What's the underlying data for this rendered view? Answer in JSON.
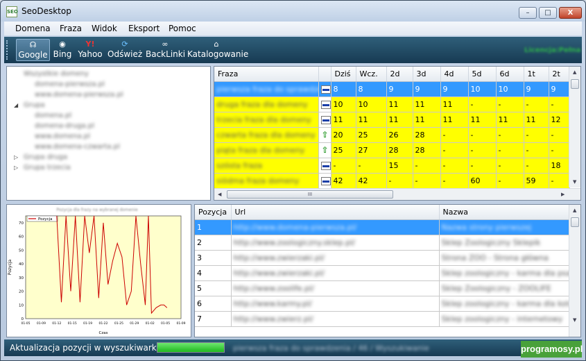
{
  "window": {
    "title": "SeoDesktop",
    "min": "–",
    "max": "□",
    "close": "X"
  },
  "menu": [
    "Domena",
    "Fraza",
    "Widok",
    "Eksport",
    "Pomoc"
  ],
  "toolbar": {
    "buttons": [
      {
        "label": "Google",
        "icon": "google-icon",
        "active": true
      },
      {
        "label": "Bing",
        "icon": "bing-icon"
      },
      {
        "label": "Yahoo",
        "icon": "yahoo-icon"
      },
      {
        "label": "Odśwież",
        "icon": "refresh-icon"
      },
      {
        "label": "BackLinki",
        "icon": "link-icon"
      },
      {
        "label": "Katalogowanie",
        "icon": "catalog-icon"
      }
    ],
    "license": "Licencja:Pełna"
  },
  "tree": [
    {
      "label": "Wszystkie domeny",
      "level": 0,
      "toggle": ""
    },
    {
      "label": "domena-pierwsza.pl",
      "level": 1,
      "toggle": ""
    },
    {
      "label": "www.domena-pierwsza.pl",
      "level": 1,
      "toggle": ""
    },
    {
      "label": "Grupa",
      "level": 0,
      "toggle": "◢"
    },
    {
      "label": "domena.pl",
      "level": 1,
      "toggle": ""
    },
    {
      "label": "domena-druga.pl",
      "level": 1,
      "toggle": ""
    },
    {
      "label": "www.domena.pl",
      "level": 1,
      "toggle": ""
    },
    {
      "label": "www.domena-czwarta.pl",
      "level": 1,
      "toggle": ""
    },
    {
      "label": "Grupa druga",
      "level": 0,
      "toggle": "▷"
    },
    {
      "label": "Grupa trzecia",
      "level": 0,
      "toggle": "▷"
    }
  ],
  "phrase_grid": {
    "columns": [
      "Fraza",
      "",
      "Dziś",
      "Wcz.",
      "2d",
      "3d",
      "4d",
      "5d",
      "6d",
      "1t",
      "2t"
    ],
    "rows": [
      {
        "phrase": "pierwsza fraza do sprawdzenia",
        "trend": "flat",
        "values": [
          "8",
          "8",
          "9",
          "9",
          "9",
          "10",
          "10",
          "9",
          "9"
        ],
        "style": "sel"
      },
      {
        "phrase": "druga fraza dla domeny",
        "trend": "flat",
        "values": [
          "10",
          "10",
          "11",
          "11",
          "11",
          "-",
          "-",
          "-",
          "-"
        ],
        "style": "yellow"
      },
      {
        "phrase": "trzecia fraza dla domeny",
        "trend": "flat",
        "values": [
          "11",
          "11",
          "11",
          "11",
          "11",
          "11",
          "11",
          "11",
          "12"
        ],
        "style": "yellow"
      },
      {
        "phrase": "czwarta fraza dla domeny",
        "trend": "up",
        "values": [
          "20",
          "25",
          "26",
          "28",
          "-",
          "-",
          "-",
          "-",
          "-"
        ],
        "style": "yellow"
      },
      {
        "phrase": "piąta fraza dla domeny",
        "trend": "up",
        "values": [
          "25",
          "27",
          "28",
          "28",
          "-",
          "-",
          "-",
          "-",
          "-"
        ],
        "style": "yellow"
      },
      {
        "phrase": "szósta fraza",
        "trend": "flat",
        "values": [
          "-",
          "-",
          "15",
          "-",
          "-",
          "-",
          "-",
          "-",
          "18"
        ],
        "style": "yellow"
      },
      {
        "phrase": "siódma fraza domeny",
        "trend": "flat",
        "values": [
          "42",
          "42",
          "-",
          "-",
          "-",
          "60",
          "-",
          "59",
          "-"
        ],
        "style": "yellow"
      }
    ],
    "hscroll_grip": "III"
  },
  "chart_data": {
    "type": "line",
    "title": "Pozycja dla frazy na wybranej domenie",
    "xlabel": "Czas",
    "ylabel": "Pozycja",
    "legend": "Pozycja",
    "xticks": [
      "01-05",
      "01-09",
      "01-12",
      "01-15",
      "01-19",
      "01-22",
      "01-25",
      "01-29",
      "01-02",
      "01-05",
      "01-09"
    ],
    "yticks": [
      "0",
      "10",
      "20",
      "30",
      "40",
      "50",
      "60",
      "70"
    ],
    "ylim": [
      0,
      75
    ],
    "xlim": [
      0,
      10
    ],
    "x": [
      2.0,
      2.3,
      2.6,
      2.9,
      3.2,
      3.5,
      3.8,
      4.1,
      4.4,
      4.7,
      5.0,
      5.3,
      5.6,
      5.9,
      6.2,
      6.5,
      6.8,
      7.1,
      7.4,
      7.7,
      7.9,
      8.1,
      8.4,
      8.7,
      8.9,
      9.1
    ],
    "y": [
      75,
      12,
      75,
      20,
      75,
      12,
      75,
      48,
      75,
      15,
      70,
      25,
      42,
      55,
      45,
      10,
      20,
      75,
      40,
      10,
      75,
      4,
      8,
      10,
      10,
      8
    ],
    "color": "#cc0000"
  },
  "url_grid": {
    "columns": [
      "Pozycja",
      "Url",
      "Nazwa"
    ],
    "rows": [
      {
        "pos": "1",
        "url": "http://www.domena-pierwsza.pl/",
        "name": "Nazwa strony pierwszej"
      },
      {
        "pos": "2",
        "url": "http://www.zoologiczny.sklep.pl/",
        "name": "Sklep Zoologiczny Sklepik"
      },
      {
        "pos": "3",
        "url": "http://www.zwierzaki.pl/",
        "name": "Strona ZOO - Strona główna"
      },
      {
        "pos": "4",
        "url": "http://www.zwierzaki.pl/",
        "name": "Sklep zoologiczny - karma dla psa"
      },
      {
        "pos": "5",
        "url": "http://www.zoolife.pl/",
        "name": "Sklep Zoologiczny - ZOOLIFE"
      },
      {
        "pos": "6",
        "url": "http://www.karmy.pl/",
        "name": "Sklep zoologiczny - karma dla kota"
      },
      {
        "pos": "7",
        "url": "http://www.zwierz.pl/",
        "name": "Sklep zoologiczny - internetowy"
      }
    ]
  },
  "status": {
    "text": "Aktualizacja pozycji w wyszukiwarkach",
    "progress": 1.0,
    "detail": "pierwsza fraza do sprawdzenia / 46 / Wyszukiwanie"
  },
  "watermark": "programosy.pl"
}
